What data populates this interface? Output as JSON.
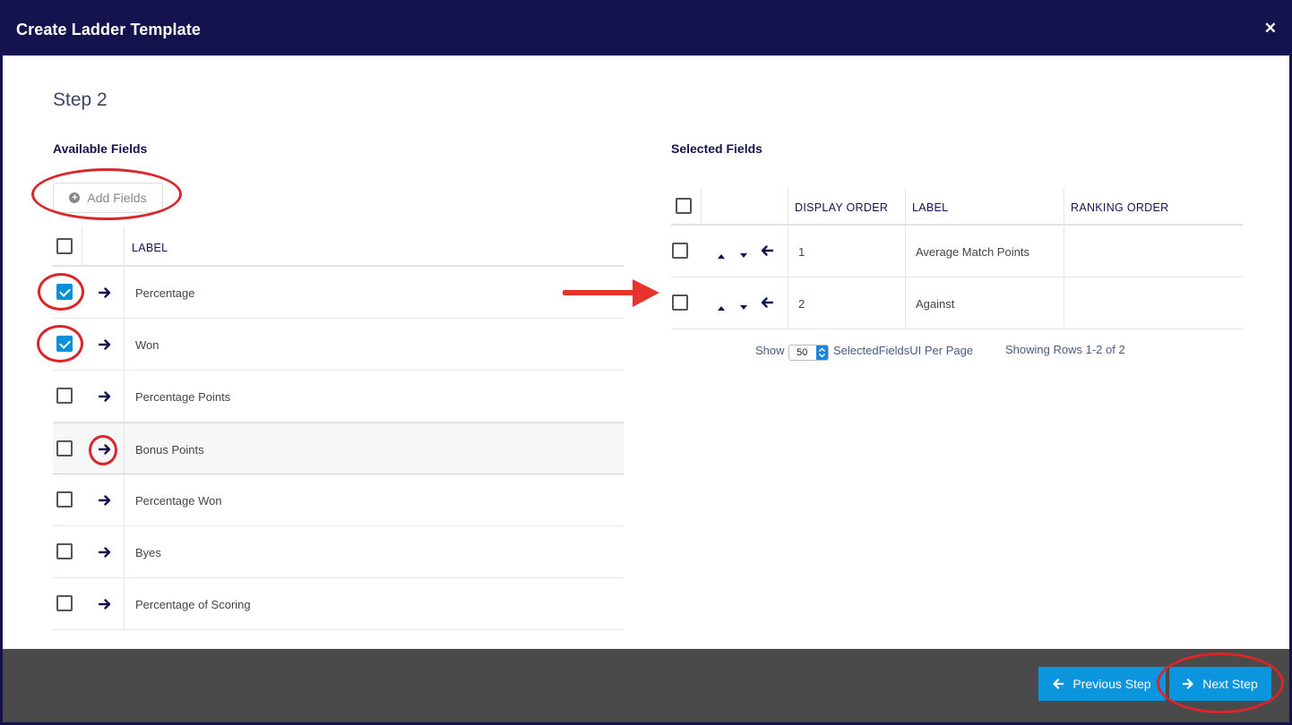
{
  "modal": {
    "title": "Create Ladder Template"
  },
  "step": "Step 2",
  "available": {
    "title": "Available Fields",
    "add_button": "Add Fields",
    "header_label": "LABEL",
    "rows": [
      {
        "label": "Percentage",
        "checked": true
      },
      {
        "label": "Won",
        "checked": true
      },
      {
        "label": "Percentage Points",
        "checked": false
      },
      {
        "label": "Bonus Points",
        "checked": false
      },
      {
        "label": "Percentage Won",
        "checked": false
      },
      {
        "label": "Byes",
        "checked": false
      },
      {
        "label": "Percentage of Scoring",
        "checked": false
      }
    ]
  },
  "selected": {
    "title": "Selected Fields",
    "headers": {
      "display_order": "DISPLAY ORDER",
      "label": "LABEL",
      "ranking_order": "RANKING ORDER"
    },
    "rows": [
      {
        "order": "1",
        "label": "Average Match Points",
        "ranking": ""
      },
      {
        "order": "2",
        "label": "Against",
        "ranking": ""
      }
    ],
    "pager": {
      "show": "Show",
      "per_page_value": "50",
      "per_page_label": "SelectedFieldsUI Per Page",
      "showing": "Showing Rows 1-2 of 2"
    }
  },
  "footer": {
    "previous": "Previous Step",
    "next": "Next Step"
  },
  "colors": {
    "header_bg": "#14134e",
    "accent": "#0a95de",
    "footer_bg": "#4a4a4a",
    "annotation": "#d8262a"
  }
}
